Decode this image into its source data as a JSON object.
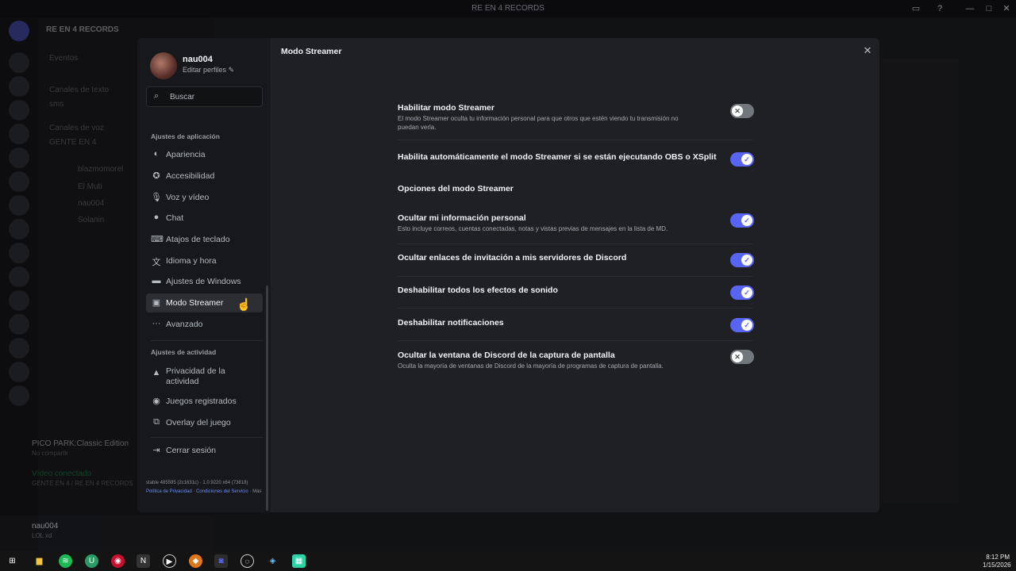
{
  "window": {
    "title": "RE EN 4 RECORDS"
  },
  "background": {
    "server_name": "RE EN 4 RECORDS",
    "channels": [
      "Eventos",
      "Canales de texto",
      "sms",
      "Canales de voz",
      "GENTE EN 4",
      "blazmomorel",
      "El Muti",
      "nau004",
      "Solanin"
    ],
    "game": "PICO PARK:Classic Edition",
    "game_sub": "No compartir",
    "voice_status": "Vídeo conectado",
    "voice_channel": "GENTE EN 4 / RE EN 4 RECORDS",
    "user": "nau004",
    "user_status": "LOL xd"
  },
  "profile": {
    "username": "nau004",
    "edit_label": "Editar perfiles"
  },
  "search": {
    "placeholder": "Buscar"
  },
  "sidebar": {
    "app_section": "Ajustes de aplicación",
    "app_items": [
      {
        "label": "Apariencia",
        "icon": "palette-icon"
      },
      {
        "label": "Accesibilidad",
        "icon": "accessibility-icon"
      },
      {
        "label": "Voz y vídeo",
        "icon": "microphone-icon"
      },
      {
        "label": "Chat",
        "icon": "chat-bubble-icon"
      },
      {
        "label": "Atajos de teclado",
        "icon": "keyboard-icon"
      },
      {
        "label": "Idioma y hora",
        "icon": "language-icon"
      },
      {
        "label": "Ajustes de Windows",
        "icon": "monitor-icon"
      },
      {
        "label": "Modo Streamer",
        "icon": "stream-icon"
      },
      {
        "label": "Avanzado",
        "icon": "more-icon"
      }
    ],
    "activity_section": "Ajustes de actividad",
    "activity_items": [
      {
        "label": "Privacidad de la actividad",
        "icon": "privacy-icon"
      },
      {
        "label": "Juegos registrados",
        "icon": "gamepad-icon"
      },
      {
        "label": "Overlay del juego",
        "icon": "overlay-icon"
      }
    ],
    "logout": "Cerrar sesión",
    "footer": {
      "build": "stable 485595 (2c1631c) · 1.0.9220 x64 (73818)",
      "privacy": "Política de Privacidad",
      "terms": "Condiciones del Servicio",
      "more": "Más"
    }
  },
  "content": {
    "title": "Modo Streamer",
    "settings": [
      {
        "label": "Habilitar modo Streamer",
        "desc": "El modo Streamer oculta tu información personal para que otros que estén viendo tu transmisión no puedan verla.",
        "enabled": false
      },
      {
        "label": "Habilita automáticamente el modo Streamer si se están ejecutando OBS o XSplit",
        "desc": "",
        "enabled": true
      },
      {
        "label": "Ocultar mi información personal",
        "desc": "Esto incluye correos, cuentas conectadas, notas y vistas previas de mensajes en la lista de MD.",
        "enabled": true
      },
      {
        "label": "Ocultar enlaces de invitación a mis servidores de Discord",
        "desc": "",
        "enabled": true
      },
      {
        "label": "Deshabilitar todos los efectos de sonido",
        "desc": "",
        "enabled": true
      },
      {
        "label": "Deshabilitar notificaciones",
        "desc": "",
        "enabled": true
      },
      {
        "label": "Ocultar la ventana de Discord de la captura de pantalla",
        "desc": "Oculta la mayoría de ventanas de Discord de la mayoría de programas de captura de pantalla.",
        "enabled": false
      }
    ],
    "options_heading": "Opciones del modo Streamer"
  },
  "taskbar": {
    "time": "8:12 PM",
    "date": "1/15/2026"
  }
}
